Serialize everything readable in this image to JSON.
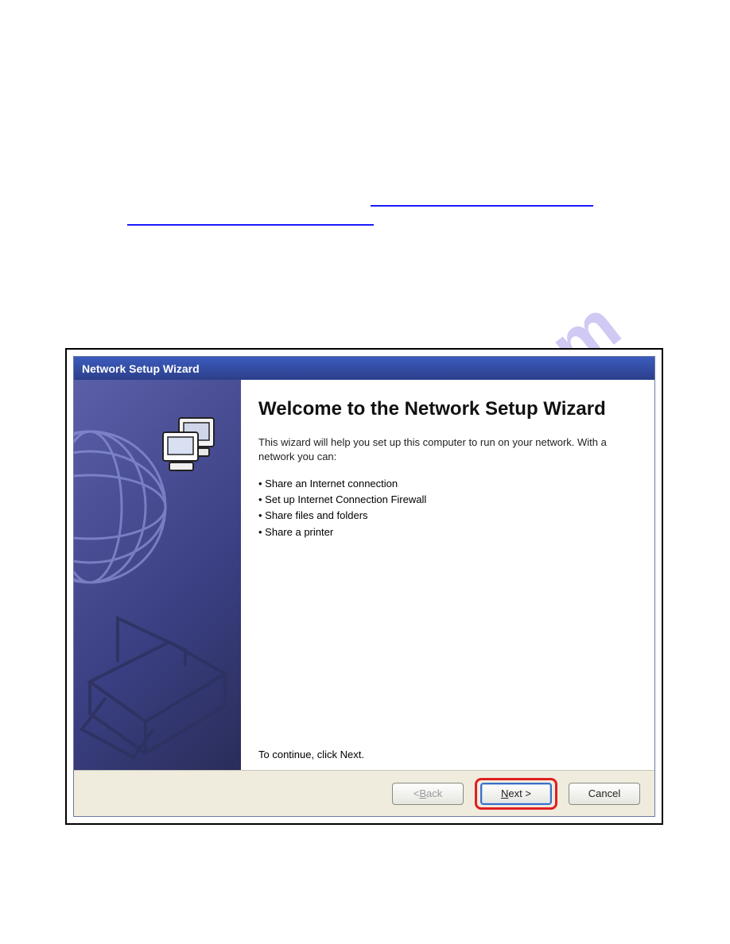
{
  "wizard": {
    "titlebar": "Network Setup Wizard",
    "heading": "Welcome to the Network Setup Wizard",
    "intro": "This wizard will help you set up this computer to run on your network. With a network you can:",
    "bullets": [
      "Share an Internet connection",
      "Set up Internet Connection Firewall",
      "Share files and folders",
      "Share a printer"
    ],
    "continue_note": "To continue, click Next.",
    "buttons": {
      "back_prefix": "< ",
      "back_ul": "B",
      "back_suffix": "ack",
      "next_ul": "N",
      "next_suffix": "ext >",
      "cancel": "Cancel"
    }
  },
  "watermark": "manualshive.com"
}
